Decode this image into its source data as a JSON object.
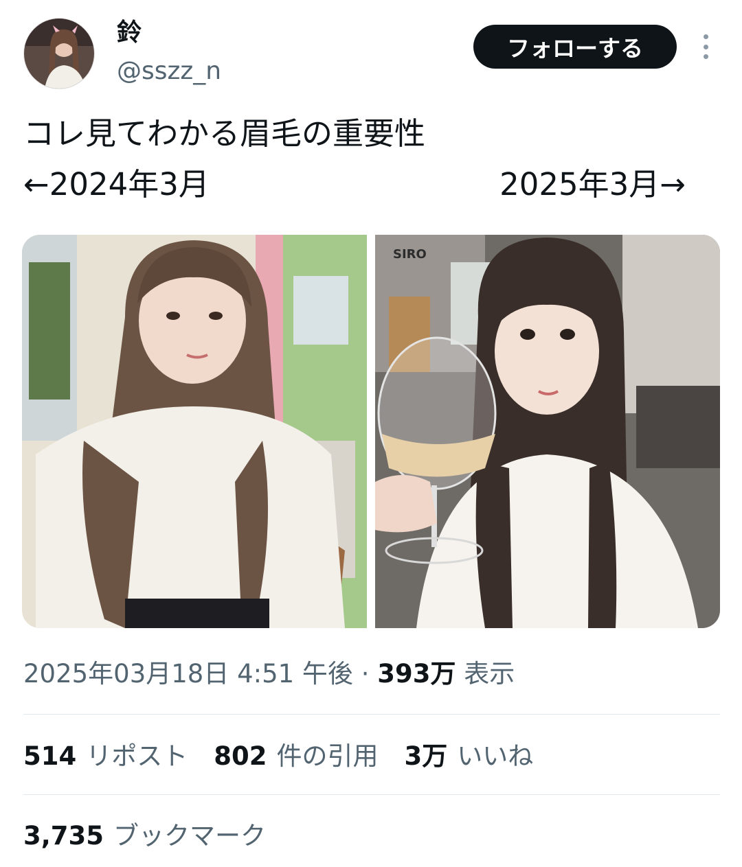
{
  "author": {
    "display_name": "鈴",
    "handle": "@sszz_n"
  },
  "follow_button_label": "フォローする",
  "post": {
    "text_line1": "コレ見てわかる眉毛の重要性",
    "text_line2_left": "←2024年3月",
    "text_line2_right": "2025年3月→"
  },
  "media": {
    "photo1_sign_text": "",
    "photo2_sign_text": "SIRO"
  },
  "meta": {
    "timestamp": "2025年03月18日 4:51 午後",
    "separator": " · ",
    "views_count": "393万",
    "views_label": " 表示"
  },
  "stats": {
    "reposts_count": "514",
    "reposts_label": "リポスト",
    "quotes_count": "802",
    "quotes_label": "件の引用",
    "likes_count": "3万",
    "likes_label": "いいね"
  },
  "bookmarks": {
    "count": "3,735",
    "label": "ブックマーク"
  },
  "colors": {
    "primary_text": "#0f1419",
    "secondary_text": "#536471",
    "divider": "#e1e8ed",
    "button_bg": "#0f1419"
  },
  "icons": {
    "more": "more-vertical-icon"
  }
}
